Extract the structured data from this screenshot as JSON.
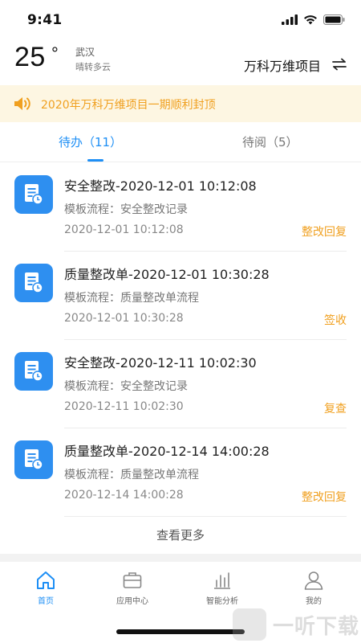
{
  "status_bar": {
    "time": "9:41"
  },
  "header": {
    "temperature": "25",
    "degree_symbol": "°",
    "city": "武汉",
    "weather": "晴转多云",
    "project_name": "万科万维项目"
  },
  "notice": {
    "text": "2020年万科万维项目一期顺利封顶"
  },
  "tabs": [
    {
      "label": "待办",
      "count": "（11）",
      "active": true
    },
    {
      "label": "待阅",
      "count": "（5）",
      "active": false
    }
  ],
  "tasks": [
    {
      "title": "安全整改-2020-12-01 10:12:08",
      "template": "模板流程：安全整改记录",
      "time": "2020-12-01 10:12:08",
      "action": "整改回复"
    },
    {
      "title": "质量整改单-2020-12-01 10:30:28",
      "template": "模板流程：质量整改单流程",
      "time": "2020-12-01 10:30:28",
      "action": "签收"
    },
    {
      "title": "安全整改-2020-12-11 10:02:30",
      "template": "模板流程：安全整改记录",
      "time": "2020-12-11 10:02:30",
      "action": "复查"
    },
    {
      "title": "质量整改单-2020-12-14 14:00:28",
      "template": "模板流程：质量整改单流程",
      "time": "2020-12-14 14:00:28",
      "action": "整改回复"
    }
  ],
  "more_label": "查看更多",
  "bottom_nav": [
    {
      "label": "首页",
      "icon": "home-icon",
      "active": true
    },
    {
      "label": "应用中心",
      "icon": "briefcase-icon",
      "active": false
    },
    {
      "label": "智能分析",
      "icon": "bar-chart-icon",
      "active": false
    },
    {
      "label": "我的",
      "icon": "user-icon",
      "active": false
    }
  ],
  "watermark": {
    "text": "一听下载",
    "badge_text": "听"
  },
  "colors": {
    "accent": "#1e8ff5",
    "action": "#f0a020",
    "notice_bg": "#fdf6e2",
    "task_icon_bg": "#2e8ff0"
  }
}
